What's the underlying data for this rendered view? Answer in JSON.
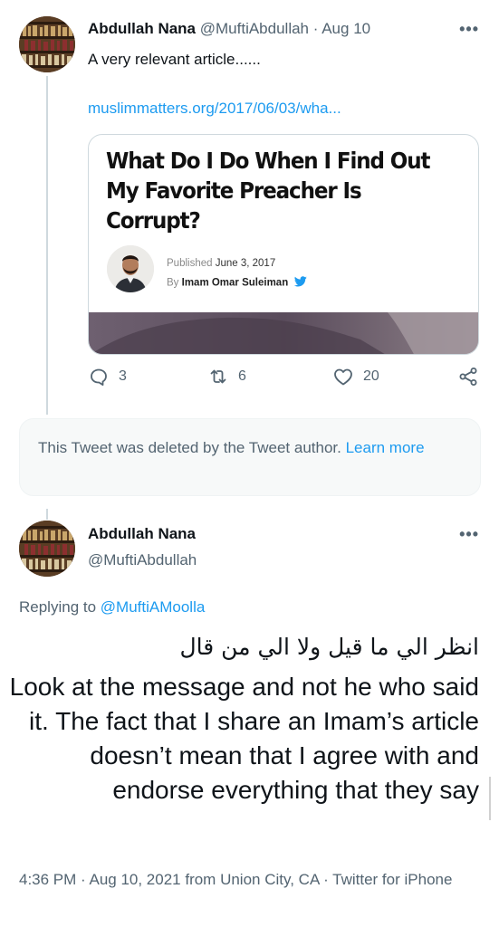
{
  "tweet1": {
    "display_name": "Abdullah Nana",
    "handle": "@MuftiAbdullah",
    "separator": "·",
    "date": "Aug 10",
    "more_label": "•••",
    "text": "A very relevant article......",
    "link": "muslimmatters.org/2017/06/03/wha...",
    "card": {
      "title": "What Do I Do When I Find Out My Favorite Preacher Is Corrupt?",
      "published_prefix": "Published",
      "published_date": "June 3, 2017",
      "by_prefix": "By",
      "author": "Imam Omar Suleiman"
    },
    "actions": {
      "replies": "3",
      "retweets": "6",
      "likes": "20"
    }
  },
  "deleted_notice": {
    "text": "This Tweet was deleted by the Tweet author.",
    "learn_more": "Learn more"
  },
  "tweet2": {
    "display_name": "Abdullah Nana",
    "handle": "@MuftiAbdullah",
    "more_label": "•••",
    "replying_prefix": "Replying to",
    "replying_to": "@MuftiAMoolla",
    "arabic_text": "انظر الي ما قيل ولا الي من قال",
    "text": "Look at the message and not he who said it. The fact that I share an Imam’s article doesn’t mean that I agree with and endorse everything that they say",
    "meta": "4:36 PM · Aug 10, 2021 from Union City, CA · Twitter for iPhone"
  },
  "colors": {
    "link": "#1d9bf0",
    "muted": "#536471",
    "text": "#0f1419",
    "twitter_bird": "#1d9bf0"
  },
  "icons": [
    "reply-icon",
    "retweet-icon",
    "like-icon",
    "share-icon",
    "more-icon",
    "twitter-bird-icon"
  ]
}
